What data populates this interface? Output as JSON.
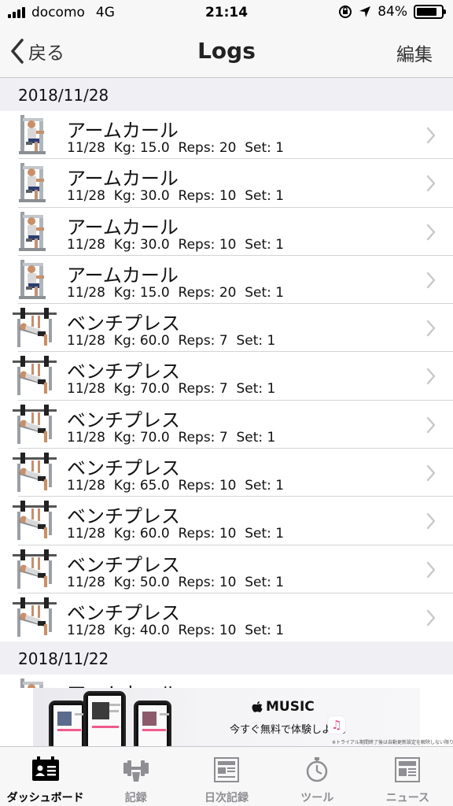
{
  "status_bar": {
    "carrier": "docomo",
    "network": "4G",
    "time": "21:14",
    "battery_percent": "84%",
    "battery_level": 0.84
  },
  "nav": {
    "back_label": "戻る",
    "title": "Logs",
    "edit_label": "編集"
  },
  "sections": [
    {
      "date": "2018/11/28",
      "rows": [
        {
          "title": "アームカール",
          "detail": "11/28  Kg: 15.0  Reps: 20  Set: 1",
          "exercise_icon": "arm-curl-machine-icon"
        },
        {
          "title": "アームカール",
          "detail": "11/28  Kg: 30.0  Reps: 10  Set: 1",
          "exercise_icon": "arm-curl-machine-icon"
        },
        {
          "title": "アームカール",
          "detail": "11/28  Kg: 30.0  Reps: 10  Set: 1",
          "exercise_icon": "arm-curl-machine-icon"
        },
        {
          "title": "アームカール",
          "detail": "11/28  Kg: 15.0  Reps: 20  Set: 1",
          "exercise_icon": "arm-curl-machine-icon"
        },
        {
          "title": "ベンチプレス",
          "detail": "11/28  Kg: 60.0  Reps: 7  Set: 1",
          "exercise_icon": "bench-press-icon"
        },
        {
          "title": "ベンチプレス",
          "detail": "11/28  Kg: 70.0  Reps: 7  Set: 1",
          "exercise_icon": "bench-press-icon"
        },
        {
          "title": "ベンチプレス",
          "detail": "11/28  Kg: 70.0  Reps: 7  Set: 1",
          "exercise_icon": "bench-press-icon"
        },
        {
          "title": "ベンチプレス",
          "detail": "11/28  Kg: 65.0  Reps: 10  Set: 1",
          "exercise_icon": "bench-press-icon"
        },
        {
          "title": "ベンチプレス",
          "detail": "11/28  Kg: 60.0  Reps: 10  Set: 1",
          "exercise_icon": "bench-press-icon"
        },
        {
          "title": "ベンチプレス",
          "detail": "11/28  Kg: 50.0  Reps: 10  Set: 1",
          "exercise_icon": "bench-press-icon"
        },
        {
          "title": "ベンチプレス",
          "detail": "11/28  Kg: 40.0  Reps: 10  Set: 1",
          "exercise_icon": "bench-press-icon"
        }
      ]
    },
    {
      "date": "2018/11/22",
      "rows": [
        {
          "title": "アームカール",
          "detail": "",
          "exercise_icon": "arm-curl-machine-icon"
        }
      ]
    }
  ],
  "ad": {
    "brand": "MUSIC",
    "tagline": "今すぐ無料で体験しよう。",
    "fine_print": "※トライアル期間終了後は自動更新設定を解除しない限り..."
  },
  "tabs": [
    {
      "label": "ダッシュボード",
      "icon": "dashboard-icon",
      "active": true
    },
    {
      "label": "記録",
      "icon": "dumbbell-icon",
      "active": false
    },
    {
      "label": "日次記録",
      "icon": "daily-log-icon",
      "active": false
    },
    {
      "label": "ツール",
      "icon": "stopwatch-icon",
      "active": false
    },
    {
      "label": "ニュース",
      "icon": "news-icon",
      "active": false
    }
  ],
  "colors": {
    "bar_background": "#f7f7f7",
    "section_background": "#efeff4",
    "separator": "#d4d4d8",
    "chevron": "#c7c7cc",
    "tab_inactive": "#8e8e93"
  }
}
